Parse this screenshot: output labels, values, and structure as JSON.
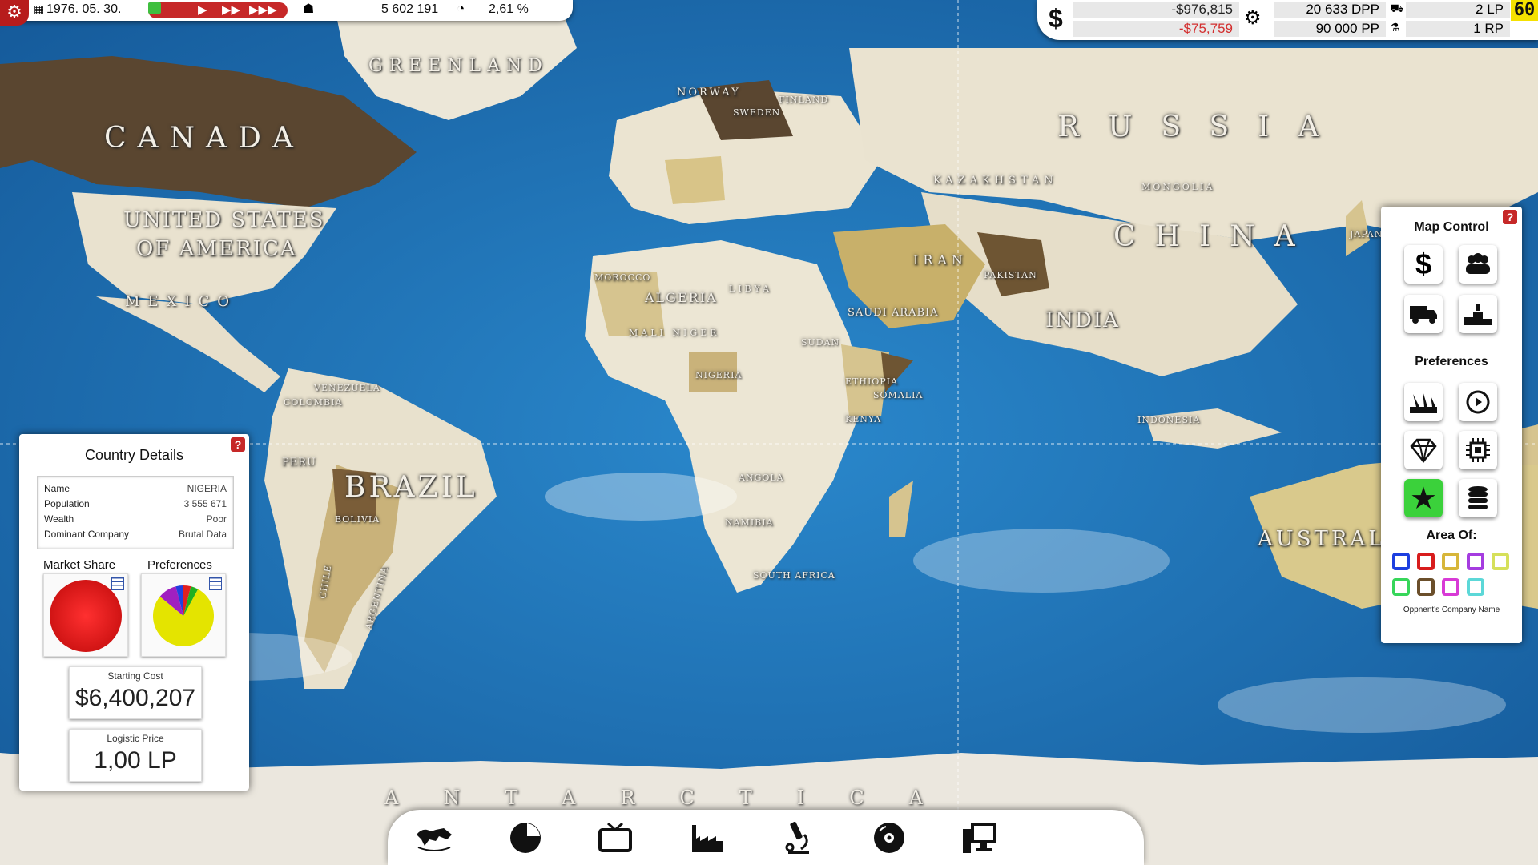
{
  "top_left": {
    "date": "1976. 05. 30.",
    "money_stat": "5 602 191",
    "percent_stat": "2,61 %"
  },
  "top_right": {
    "balance": "-$976,815",
    "change": "-$75,759",
    "dpp": "20 633 DPP",
    "pp": "90 000 PP",
    "lp": "2 LP",
    "rp": "1 RP",
    "fps": "60"
  },
  "map_labels": {
    "greenland": "GREENLAND",
    "canada": "CANADA",
    "usa_1": "UNITED STATES",
    "usa_2": "OF AMERICA",
    "mexico": "MEXICO",
    "norway": "NORWAY",
    "sweden": "SWEDEN",
    "finland": "FINLAND",
    "russia": "RUSSIA",
    "kazakhstan": "KAZAKHSTAN",
    "mongolia": "MONGOLIA",
    "china": "CHINA",
    "japan": "JAPAN",
    "iran": "IRAN",
    "pakistan": "PAKISTAN",
    "india": "INDIA",
    "saudi": "SAUDI ARABIA",
    "morocco": "MOROCCO",
    "algeria": "ALGERIA",
    "libya": "LIBYA",
    "mali": "MALI NIGER",
    "sudan": "SUDAN",
    "nigeria": "NIGERIA",
    "ethiopia": "ETHIOPIA",
    "somalia": "SOMALIA",
    "kenya": "KENYA",
    "angola": "ANGOLA",
    "namibia": "NAMIBIA",
    "south_africa": "SOUTH AFRICA",
    "indonesia": "INDONESIA",
    "venezuela": "VENEZUELA",
    "colombia": "COLOMBIA",
    "peru": "PERU",
    "brazil": "BRAZIL",
    "bolivia": "BOLIVIA",
    "chile": "CHILE",
    "argentina": "ARGENTINA",
    "australia": "AUSTRALIA",
    "antarctica": "ANTARCTICA"
  },
  "country_details": {
    "title": "Country Details",
    "help": "?",
    "rows": [
      {
        "label": "Name",
        "value": "NIGERIA"
      },
      {
        "label": "Population",
        "value": "3 555 671"
      },
      {
        "label": "Wealth",
        "value": "Poor"
      },
      {
        "label": "Dominant Company",
        "value": "Brutal Data"
      }
    ],
    "market_share_label": "Market Share",
    "preferences_label": "Preferences",
    "starting_cost_label": "Starting Cost",
    "starting_cost_value": "$6,400,207",
    "logistic_price_label": "Logistic Price",
    "logistic_price_value": "1,00 LP",
    "market_share_color": "#e41b1b",
    "preferences_slices": [
      {
        "color": "#e4e400",
        "value": 0.78
      },
      {
        "color": "#a020c0",
        "value": 0.1
      },
      {
        "color": "#2040e0",
        "value": 0.04
      },
      {
        "color": "#e02020",
        "value": 0.04
      },
      {
        "color": "#20b020",
        "value": 0.04
      }
    ]
  },
  "map_control": {
    "title": "Map Control",
    "help": "?",
    "preferences_title": "Preferences",
    "area_of_title": "Area Of:",
    "opponent_label": "Oppnent's Company Name",
    "buttons": [
      "dollar-icon",
      "population-icon",
      "truck-icon",
      "podium-icon"
    ],
    "pref_buttons": [
      "tools-icon",
      "replay-icon",
      "diamond-icon",
      "chip-icon",
      "star-icon",
      "database-icon"
    ],
    "swatches": [
      "#1d3fe0",
      "#d81c1c",
      "#d7b63a",
      "#a53ce0",
      "#d6e05a",
      "#37d65a",
      "#6b4f2b",
      "#d83ad6",
      "#5cd8d8"
    ]
  },
  "bottom_bar": [
    "globe-icon",
    "pie-chart-icon",
    "tv-icon",
    "factory-icon",
    "microscope-icon",
    "disc-icon",
    "computer-icon"
  ]
}
